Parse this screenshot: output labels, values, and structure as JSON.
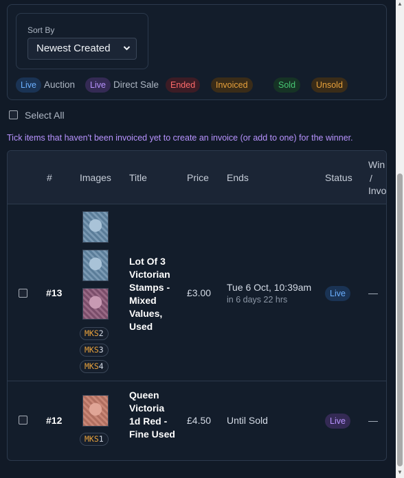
{
  "filters": {
    "sort_label": "Sort By",
    "sort_value": "Newest Created",
    "legend": [
      {
        "pill": "Live",
        "text": "Auction"
      },
      {
        "pill": "Live",
        "text": "Direct Sale"
      },
      {
        "pill": "Ended",
        "text": ""
      },
      {
        "pill": "Invoiced",
        "text": ""
      },
      {
        "pill": "Sold",
        "text": ""
      },
      {
        "pill": "Unsold",
        "text": ""
      }
    ]
  },
  "select_all_label": "Select All",
  "hint": "Tick items that haven't been invoiced yet to create an invoice (or add to one) for the winner.",
  "table": {
    "headers": {
      "number": "#",
      "images": "Images",
      "title": "Title",
      "price": "Price",
      "ends": "Ends",
      "status": "Status",
      "winner_l1": "Win",
      "winner_l2": "/",
      "winner_l3": "Invo"
    },
    "rows": [
      {
        "number": "#13",
        "title": "Lot Of 3 Victorian Stamps - Mixed Values, Used",
        "price": "£3.00",
        "ends": "Tue 6 Oct, 10:39am",
        "ends_sub": "in 6 days 22 hrs",
        "status": "Live",
        "winner": "—",
        "skus": [
          {
            "prefix": "MKS",
            "num": "2"
          },
          {
            "prefix": "MKS",
            "num": "3"
          },
          {
            "prefix": "MKS",
            "num": "4"
          }
        ]
      },
      {
        "number": "#12",
        "title": "Queen Victoria 1d Red - Fine Used",
        "price": "£4.50",
        "ends": "Until Sold",
        "ends_sub": "",
        "status": "Live",
        "winner": "—",
        "skus": [
          {
            "prefix": "MKS",
            "num": "1"
          }
        ]
      }
    ]
  },
  "colors": {
    "live_auction": "#6cb0ff",
    "live_direct": "#b893ff",
    "ended": "#ff6b6b",
    "invoiced": "#e9a23b",
    "sold": "#48c774",
    "unsold": "#e9a23b"
  }
}
